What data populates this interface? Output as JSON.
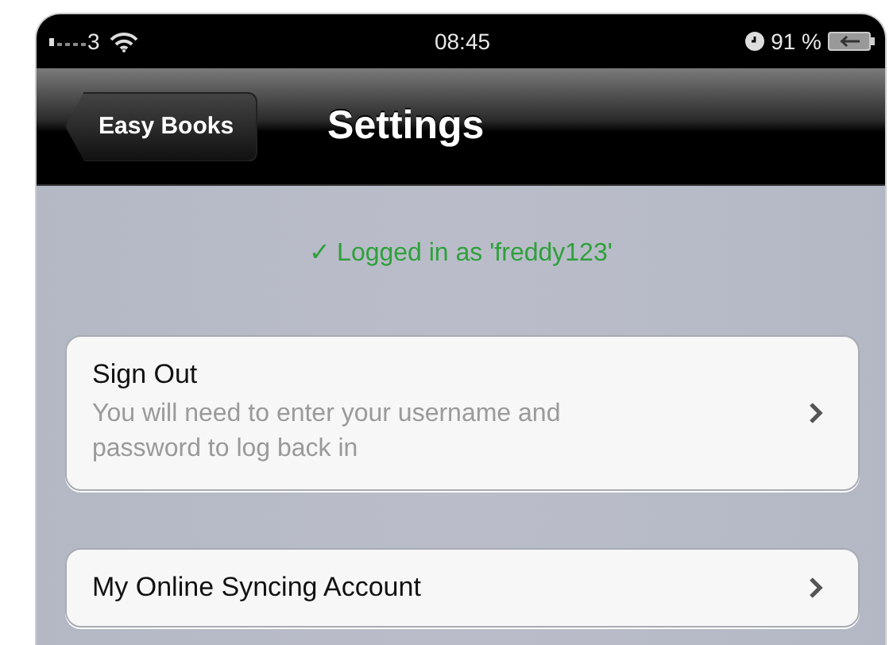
{
  "status_bar": {
    "carrier": "3",
    "time": "08:45",
    "battery": "91 %"
  },
  "nav_bar": {
    "back_button": "Easy Books",
    "title": "Settings"
  },
  "login_status": "✓ Logged in as 'freddy123'",
  "cells": [
    {
      "title": "Sign Out",
      "subtitle": "You will need to enter your username and password to log back in"
    },
    {
      "title": "My Online Syncing Account"
    }
  ]
}
